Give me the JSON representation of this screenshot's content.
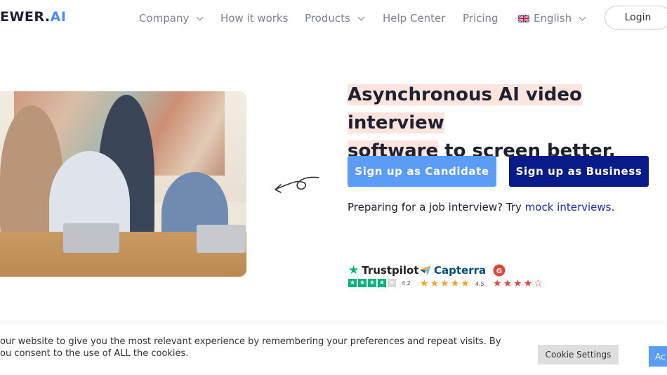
{
  "nav": {
    "logo_main": "EWER.",
    "logo_accent": "AI",
    "items": [
      {
        "label": "Company",
        "dropdown": true
      },
      {
        "label": "How it works",
        "dropdown": false
      },
      {
        "label": "Products",
        "dropdown": true
      },
      {
        "label": "Help Center",
        "dropdown": false
      },
      {
        "label": "Pricing",
        "dropdown": false
      }
    ],
    "language": "English",
    "login": "Login"
  },
  "hero": {
    "headline_hl1": "Asynchronous AI video interview",
    "headline_hl2": "software",
    "headline_rest": " to screen better, faster.",
    "btn_candidate": "Sign up as Candidate",
    "btn_business": "Sign up as Business",
    "mock_prefix": "Preparing for a job interview? Try ",
    "mock_link": "mock interviews."
  },
  "ratings": {
    "trustpilot": {
      "name": "Trustpilot",
      "score": "4.2"
    },
    "capterra": {
      "name": "Capterra",
      "score": "4.5"
    },
    "g2": {
      "name": "G2"
    }
  },
  "cookie": {
    "line1": "our website to give you the most relevant experience by remembering your preferences and repeat visits. By",
    "line2": "ou consent to the use of ALL the cookies.",
    "settings": "Cookie Settings",
    "accept": "Ac"
  },
  "colors": {
    "accent": "#5b9cf8",
    "navy": "#081b88",
    "highlight": "#fde4de",
    "trustpilot": "#00b67a",
    "capterra_star": "#f5a623",
    "g2_red": "#e2483a"
  }
}
